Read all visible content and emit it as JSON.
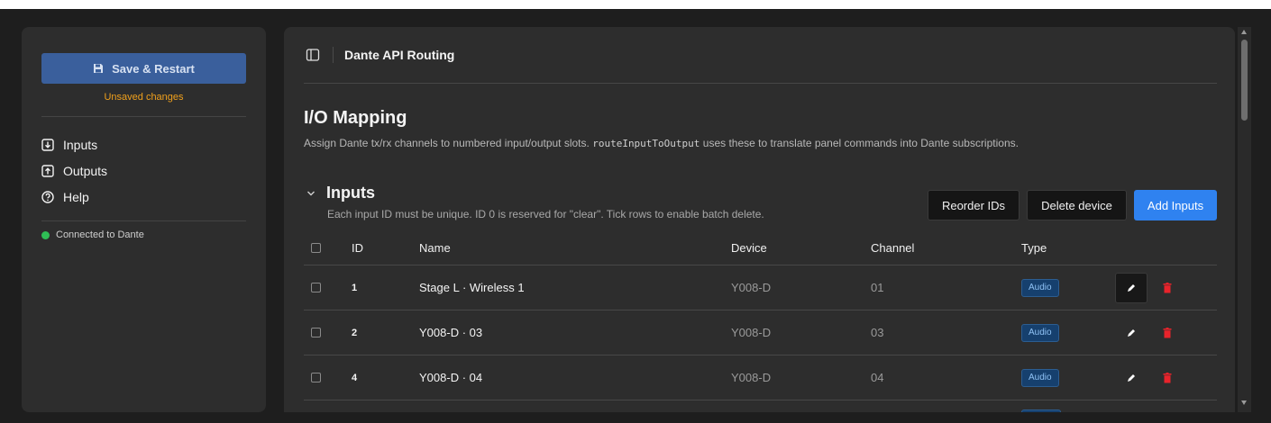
{
  "sidebar": {
    "save_label": "Save & Restart",
    "unsaved_text": "Unsaved changes",
    "nav": [
      {
        "label": "Inputs",
        "icon": "box-arrow-down-icon"
      },
      {
        "label": "Outputs",
        "icon": "box-arrow-up-icon"
      },
      {
        "label": "Help",
        "icon": "question-circle-icon"
      }
    ],
    "status_text": "Connected to Dante",
    "status_color": "#2fbd55"
  },
  "header": {
    "title": "Dante API Routing"
  },
  "page": {
    "title": "I/O Mapping",
    "description_before": "Assign Dante tx/rx channels to numbered input/output slots.",
    "description_code": "routeInputToOutput",
    "description_after": "uses these to translate panel commands into Dante subscriptions."
  },
  "section": {
    "title": "Inputs",
    "description": "Each input ID must be unique. ID 0 is reserved for \"clear\". Tick rows to enable batch delete.",
    "buttons": {
      "reorder": "Reorder IDs",
      "delete_device": "Delete device",
      "add": "Add Inputs"
    }
  },
  "table": {
    "columns": {
      "id": "ID",
      "name": "Name",
      "device": "Device",
      "channel": "Channel",
      "type": "Type"
    },
    "rows": [
      {
        "id": "1",
        "name": "Stage L · Wireless 1",
        "device": "Y008-D",
        "channel": "01",
        "type": "Audio"
      },
      {
        "id": "2",
        "name": "Y008-D · 03",
        "device": "Y008-D",
        "channel": "03",
        "type": "Audio"
      },
      {
        "id": "4",
        "name": "Y008-D · 04",
        "device": "Y008-D",
        "channel": "04",
        "type": "Audio"
      }
    ]
  },
  "colors": {
    "accent_blue": "#2f82f0",
    "warning_orange": "#f0a01c",
    "delete_red": "#e8232b",
    "badge_bg": "#16406e"
  }
}
